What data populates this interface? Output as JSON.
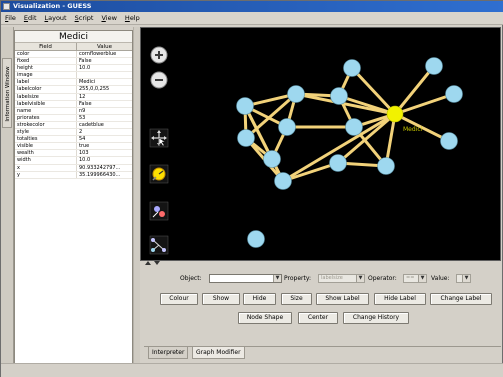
{
  "window": {
    "title": "Visualization - GUESS"
  },
  "menu": [
    {
      "label": "File"
    },
    {
      "label": "Edit"
    },
    {
      "label": "Layout"
    },
    {
      "label": "Script"
    },
    {
      "label": "View"
    },
    {
      "label": "Help"
    }
  ],
  "side_tab": {
    "label": "Information Window"
  },
  "info_panel": {
    "title": "Medici",
    "columns": {
      "field": "Field",
      "value": "Value"
    },
    "rows": [
      {
        "field": "color",
        "value": "cornflowerblue"
      },
      {
        "field": "fixed",
        "value": "False"
      },
      {
        "field": "height",
        "value": "10.0"
      },
      {
        "field": "image",
        "value": ""
      },
      {
        "field": "label",
        "value": "Medici"
      },
      {
        "field": "labelcolor",
        "value": "255,0,0,255"
      },
      {
        "field": "labelsize",
        "value": "12"
      },
      {
        "field": "labelvisible",
        "value": "False"
      },
      {
        "field": "name",
        "value": "n9"
      },
      {
        "field": "priorates",
        "value": "53"
      },
      {
        "field": "strokecolor",
        "value": "cadetblue"
      },
      {
        "field": "style",
        "value": "2"
      },
      {
        "field": "totalties",
        "value": "54"
      },
      {
        "field": "visible",
        "value": "true"
      },
      {
        "field": "wealth",
        "value": "103"
      },
      {
        "field": "width",
        "value": "10.0"
      },
      {
        "field": "x",
        "value": "90.933242797..."
      },
      {
        "field": "y",
        "value": "35.199966430..."
      }
    ]
  },
  "graph": {
    "background": "#000000",
    "node_color": "#9ed8ef",
    "selected_node_color": "#f2f200",
    "edge_color": "#f2d27a",
    "selected_label": "Medici",
    "tools": [
      {
        "name": "zoom-in-button",
        "icon": "plus-icon"
      },
      {
        "name": "zoom-out-button",
        "icon": "minus-icon"
      },
      {
        "name": "browse-tool-button",
        "icon": "browse-icon"
      },
      {
        "name": "magnify-tool-button",
        "icon": "magnifier-icon"
      },
      {
        "name": "draw-node-tool-button",
        "icon": "draw-icon"
      },
      {
        "name": "draw-edge-tool-button",
        "icon": "edge-icon"
      }
    ]
  },
  "modifier": {
    "object_label": "Object:",
    "object_value": "",
    "property_label": "Property:",
    "property_value": "labelsize",
    "operator_label": "Operator:",
    "operator_value": "==",
    "value_label": "Value:",
    "value_value": "",
    "buttons_row1": [
      "Colour",
      "Show",
      "Hide",
      "Size",
      "Show Label",
      "Hide Label",
      "Change Label"
    ],
    "buttons_row2": [
      "Node Shape",
      "Center",
      "Change History"
    ]
  },
  "bottom_tabs": [
    {
      "label": "Interpreter",
      "active": false
    },
    {
      "label": "Graph Modifier",
      "active": true
    }
  ]
}
